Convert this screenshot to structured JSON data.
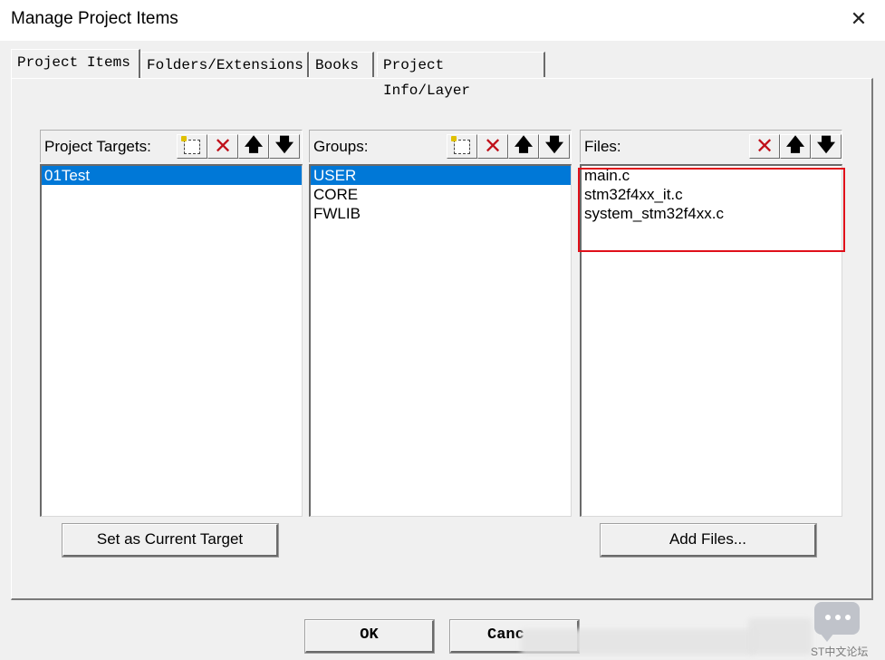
{
  "window": {
    "title": "Manage Project Items"
  },
  "tabs": [
    {
      "label": "Project Items"
    },
    {
      "label": "Folders/Extensions"
    },
    {
      "label": "Books"
    },
    {
      "label": "Project Info/Layer"
    }
  ],
  "project_targets": {
    "label": "Project Targets:",
    "items": [
      "01Test"
    ],
    "selected": "01Test"
  },
  "groups": {
    "label": "Groups:",
    "items": [
      "USER",
      "CORE",
      "FWLIB"
    ],
    "selected": "USER"
  },
  "files": {
    "label": "Files:",
    "items": [
      "main.c",
      "stm32f4xx_it.c",
      "system_stm32f4xx.c"
    ]
  },
  "buttons": {
    "set_current_target": "Set as Current Target",
    "add_files": "Add Files...",
    "ok": "OK",
    "cancel": "Canc"
  },
  "watermark": {
    "text": "ST中文论坛"
  },
  "icons": {
    "new": "new-item-icon",
    "delete": "delete-icon",
    "up": "move-up-icon",
    "down": "move-down-icon"
  },
  "colors": {
    "selection": "#0078d7",
    "highlight_border": "#e0101a",
    "delete_icon": "#c0101a"
  }
}
